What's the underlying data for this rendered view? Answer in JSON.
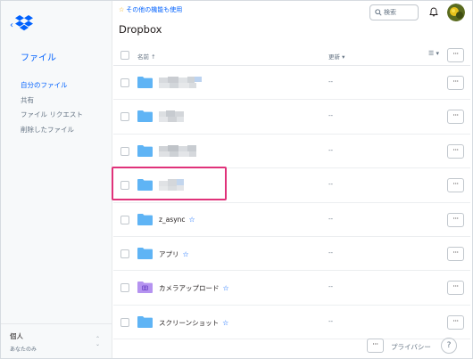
{
  "sidebar": {
    "files_label": "ファイル",
    "items": [
      {
        "label": "自分のファイル",
        "active": true
      },
      {
        "label": "共有",
        "active": false
      },
      {
        "label": "ファイル リクエスト",
        "active": false
      },
      {
        "label": "削除したファイル",
        "active": false
      }
    ],
    "account_name": "個人",
    "account_sub": "あなたのみ"
  },
  "header": {
    "promo_label": "その他の機能も使用",
    "title": "Dropbox",
    "search_placeholder": "検索"
  },
  "table": {
    "col_name": "名前 ↑",
    "col_updated": "更新 ▾",
    "view_toggle": "☰ ▾",
    "more_label": "···",
    "rows": [
      {
        "name": "",
        "blurred": true,
        "modified": "--",
        "icon": "folder-icon"
      },
      {
        "name": "",
        "blurred": true,
        "modified": "--",
        "icon": "folder-icon"
      },
      {
        "name": "",
        "blurred": true,
        "modified": "--",
        "icon": "folder-icon"
      },
      {
        "name": "",
        "blurred": true,
        "modified": "--",
        "icon": "folder-icon"
      },
      {
        "name": "z_async",
        "blurred": false,
        "modified": "--",
        "icon": "folder-icon",
        "starred": true
      },
      {
        "name": "アプリ",
        "blurred": false,
        "modified": "--",
        "icon": "folder-icon",
        "starred": true
      },
      {
        "name": "カメラアップロード",
        "blurred": false,
        "modified": "--",
        "icon": "camera-folder-icon",
        "starred": true
      },
      {
        "name": "スクリーンショット",
        "blurred": false,
        "modified": "--",
        "icon": "folder-icon",
        "starred": true
      }
    ]
  },
  "footer": {
    "more_label": "···",
    "privacy_label": "プライバシー",
    "help_label": "?"
  },
  "colors": {
    "accent": "#0061fe",
    "folder": "#5fb4f5",
    "highlight": "#e0327a",
    "camera_folder": "#b593f0"
  }
}
